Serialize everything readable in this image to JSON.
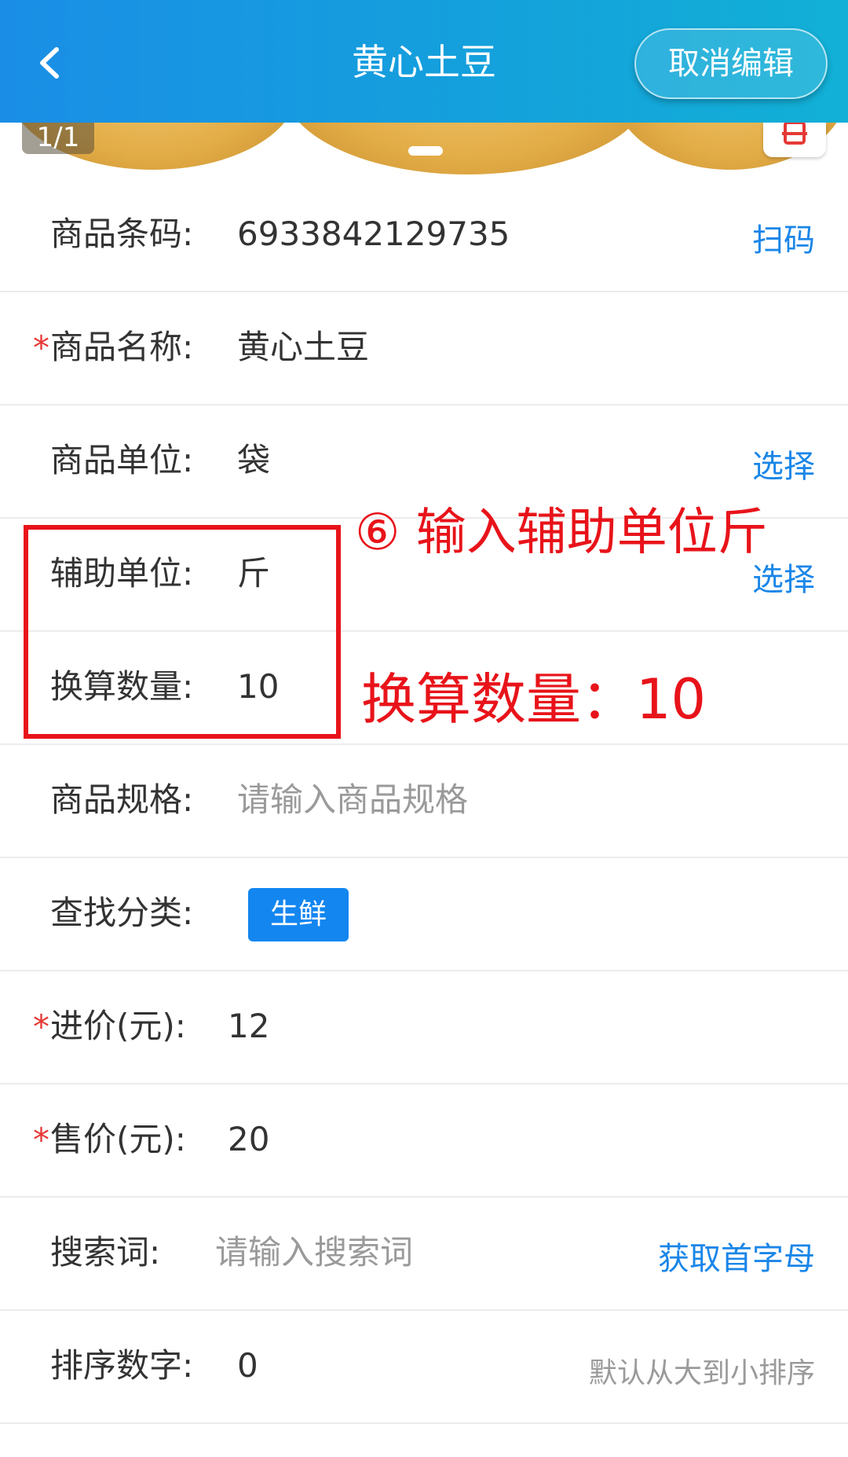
{
  "header": {
    "title": "黄心土豆",
    "cancel_label": "取消编辑"
  },
  "banner": {
    "page_indicator": "1/1"
  },
  "form": {
    "barcode": {
      "label": "商品条码:",
      "value": "6933842129735",
      "action": "扫码"
    },
    "name": {
      "required": "*",
      "label": "商品名称:",
      "value": "黄心土豆"
    },
    "unit": {
      "label": "商品单位:",
      "value": "袋",
      "action": "选择"
    },
    "aux_unit": {
      "label": "辅助单位:",
      "value": "斤",
      "action": "选择"
    },
    "conversion": {
      "label": "换算数量:",
      "value": "10"
    },
    "spec": {
      "label": "商品规格:",
      "placeholder": "请输入商品规格"
    },
    "category": {
      "label": "查找分类:",
      "tag": "生鲜"
    },
    "cost": {
      "required": "*",
      "label": "进价(元):",
      "value": "12"
    },
    "price": {
      "required": "*",
      "label": "售价(元):",
      "value": "20"
    },
    "keywords": {
      "label": "搜索词:",
      "placeholder": "请输入搜索词",
      "action": "获取首字母"
    },
    "sort": {
      "label": "排序数字:",
      "value": "0",
      "hint": "默认从大到小排序"
    }
  },
  "annotation": {
    "step_text": "⑥ 输入辅助单位斤",
    "conversion_text": "换算数量：10",
    "color": "#e8131a"
  },
  "colors": {
    "header_gradient_start": "#1a8ee6",
    "header_gradient_end": "#12b0d6",
    "accent": "#1a86e8",
    "tag": "#1386f0",
    "required": "#e53935"
  }
}
